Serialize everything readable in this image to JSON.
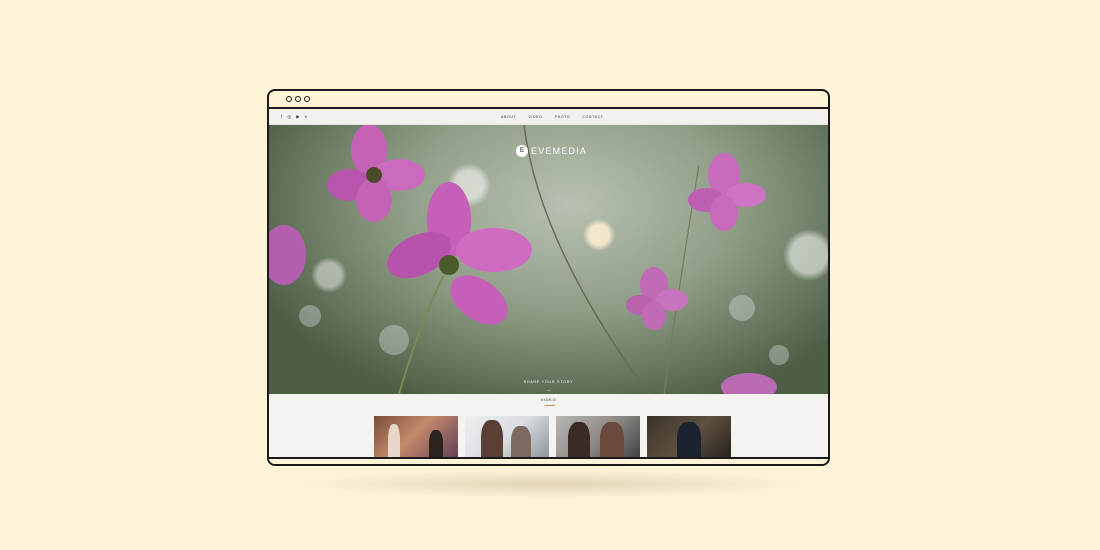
{
  "brand": {
    "logo_letter": "E",
    "name": "EVEMEDIA"
  },
  "nav": {
    "menu": [
      "ABOUT",
      "VIDEO",
      "PHOTO",
      "CONTACT"
    ],
    "social_icons": [
      "facebook-icon",
      "instagram-icon",
      "youtube-icon",
      "vimeo-icon"
    ],
    "social_glyphs": [
      "f",
      "◎",
      "▶",
      "v"
    ]
  },
  "hero": {
    "tagline": "SHARE YOUR STORY",
    "scroll_glyph": "⌄"
  },
  "video_section": {
    "title": "VIDEO",
    "thumbnails": 4
  },
  "colors": {
    "background": "#fdf4d7",
    "frame": "#1a1a1a",
    "accent": "#d08850",
    "flower": "#c55fb8"
  }
}
